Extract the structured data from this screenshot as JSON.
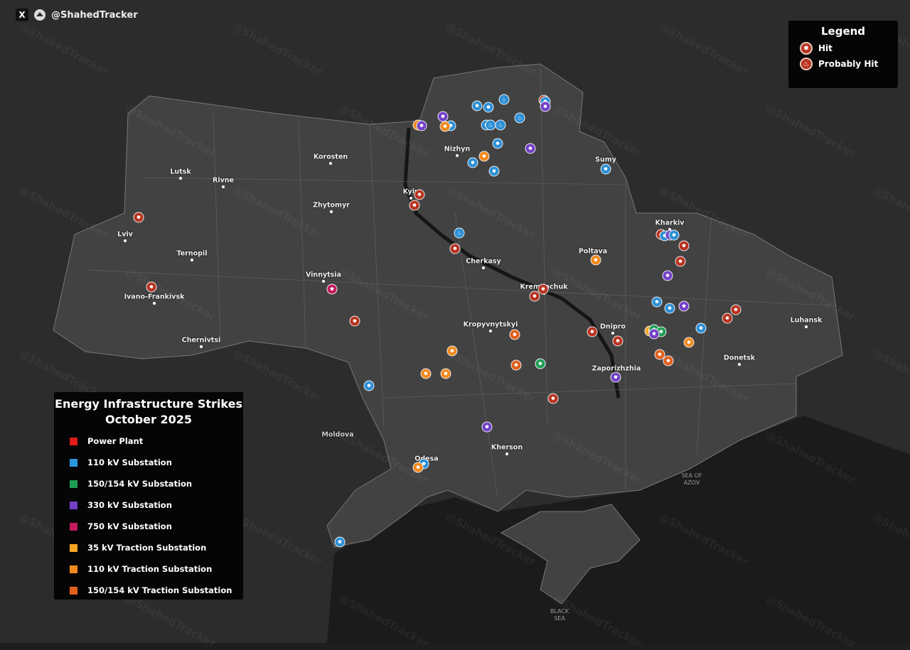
{
  "brand": {
    "x_icon": "x-logo-icon",
    "handle": "@ShahedTracker"
  },
  "legend": {
    "title": "Legend",
    "items": [
      {
        "label": "Hit",
        "icon": "explosion-icon"
      },
      {
        "label": "Probably Hit",
        "icon": "fire-icon"
      }
    ]
  },
  "key": {
    "title_line1": "Energy Infrastructure Strikes",
    "title_line2": "October 2025",
    "items": [
      {
        "label": "Power Plant",
        "color": "#e01b1b"
      },
      {
        "label": "110 kV Substation",
        "color": "#2b95e0"
      },
      {
        "label": "150/154 kV Substation",
        "color": "#1e9e55"
      },
      {
        "label": "330 kV Substation",
        "color": "#7340c8"
      },
      {
        "label": "750 kV Substation",
        "color": "#c21b5e"
      },
      {
        "label": "35 kV Traction Substation",
        "color": "#f5a623"
      },
      {
        "label": "110 kV Traction Substation",
        "color": "#f08a1e"
      },
      {
        "label": "150/154 kV Traction Substation",
        "color": "#e0601a"
      }
    ]
  },
  "marker_colors": {
    "power": "#b8321f",
    "s110": "#2b8fd6",
    "s150": "#1e9e55",
    "s330": "#7340c8",
    "s750": "#c21b5e",
    "t35": "#f5a623",
    "t110": "#f08a1e",
    "t150": "#e0601a"
  },
  "cities": [
    "Korosten",
    "Lutsk",
    "Rivne",
    "Zhytomyr",
    "Lviv",
    "Ternopil",
    "Ivano-Frankivsk",
    "Chernivtsi",
    "Vinnytsia",
    "Cherkasy",
    "Kropyvnytskyi",
    "Kremenchuk",
    "Poltava",
    "Kharkiv",
    "Sumy",
    "Nizhyn",
    "Kyiv",
    "Dnipro",
    "Zaporizhzhia",
    "Donetsk",
    "Luhansk",
    "Kherson",
    "Odesa"
  ],
  "regions": {
    "moldova": "Moldova",
    "azov": "SEA OF AZOV",
    "black_sea": "BLACK SEA"
  },
  "watermark": "@ShahedTracker",
  "markers": [
    {
      "type": "t110",
      "status": "hit"
    },
    {
      "type": "s330",
      "status": "hit"
    },
    {
      "type": "s330",
      "status": "hit"
    },
    {
      "type": "s110",
      "status": "hit"
    },
    {
      "type": "t110",
      "status": "hit"
    },
    {
      "type": "s110",
      "status": "hit"
    },
    {
      "type": "s110",
      "status": "hit"
    },
    {
      "type": "s110",
      "status": "probable"
    },
    {
      "type": "s110",
      "status": "hit"
    },
    {
      "type": "s110",
      "status": "probable"
    },
    {
      "type": "s110",
      "status": "probable"
    },
    {
      "type": "s110",
      "status": "probable"
    },
    {
      "type": "power",
      "status": "hit"
    },
    {
      "type": "s110",
      "status": "hit"
    },
    {
      "type": "s330",
      "status": "hit"
    },
    {
      "type": "s110",
      "status": "hit"
    },
    {
      "type": "s330",
      "status": "hit"
    },
    {
      "type": "t110",
      "status": "hit"
    },
    {
      "type": "s110",
      "status": "hit"
    },
    {
      "type": "s110",
      "status": "hit"
    },
    {
      "type": "s110",
      "status": "hit"
    },
    {
      "type": "power",
      "status": "hit"
    },
    {
      "type": "power",
      "status": "hit"
    },
    {
      "type": "s110",
      "status": "probable"
    },
    {
      "type": "power",
      "status": "hit"
    },
    {
      "type": "power",
      "status": "hit"
    },
    {
      "type": "power",
      "status": "hit"
    },
    {
      "type": "s750",
      "status": "hit"
    },
    {
      "type": "power",
      "status": "hit"
    },
    {
      "type": "t110",
      "status": "hit"
    },
    {
      "type": "power",
      "status": "hit"
    },
    {
      "type": "s110",
      "status": "hit"
    },
    {
      "type": "s330",
      "status": "hit"
    },
    {
      "type": "s110",
      "status": "hit"
    },
    {
      "type": "power",
      "status": "hit"
    },
    {
      "type": "power",
      "status": "hit"
    },
    {
      "type": "s330",
      "status": "hit"
    },
    {
      "type": "power",
      "status": "hit"
    },
    {
      "type": "power",
      "status": "hit"
    },
    {
      "type": "s110",
      "status": "hit"
    },
    {
      "type": "s110",
      "status": "hit"
    },
    {
      "type": "s330",
      "status": "hit"
    },
    {
      "type": "power",
      "status": "hit"
    },
    {
      "type": "power",
      "status": "hit"
    },
    {
      "type": "power",
      "status": "hit"
    },
    {
      "type": "power",
      "status": "hit"
    },
    {
      "type": "t35",
      "status": "hit"
    },
    {
      "type": "s150",
      "status": "hit"
    },
    {
      "type": "s150",
      "status": "hit"
    },
    {
      "type": "s330",
      "status": "hit"
    },
    {
      "type": "s110",
      "status": "hit"
    },
    {
      "type": "t110",
      "status": "hit"
    },
    {
      "type": "t150",
      "status": "hit"
    },
    {
      "type": "t150",
      "status": "hit"
    },
    {
      "type": "s330",
      "status": "hit"
    },
    {
      "type": "t150",
      "status": "hit"
    },
    {
      "type": "t110",
      "status": "hit"
    },
    {
      "type": "t110",
      "status": "hit"
    },
    {
      "type": "t110",
      "status": "hit"
    },
    {
      "type": "t150",
      "status": "hit"
    },
    {
      "type": "s150",
      "status": "hit"
    },
    {
      "type": "s110",
      "status": "hit"
    },
    {
      "type": "power",
      "status": "hit"
    },
    {
      "type": "s330",
      "status": "hit"
    },
    {
      "type": "s110",
      "status": "hit"
    },
    {
      "type": "t110",
      "status": "hit"
    },
    {
      "type": "s110",
      "status": "hit"
    }
  ]
}
